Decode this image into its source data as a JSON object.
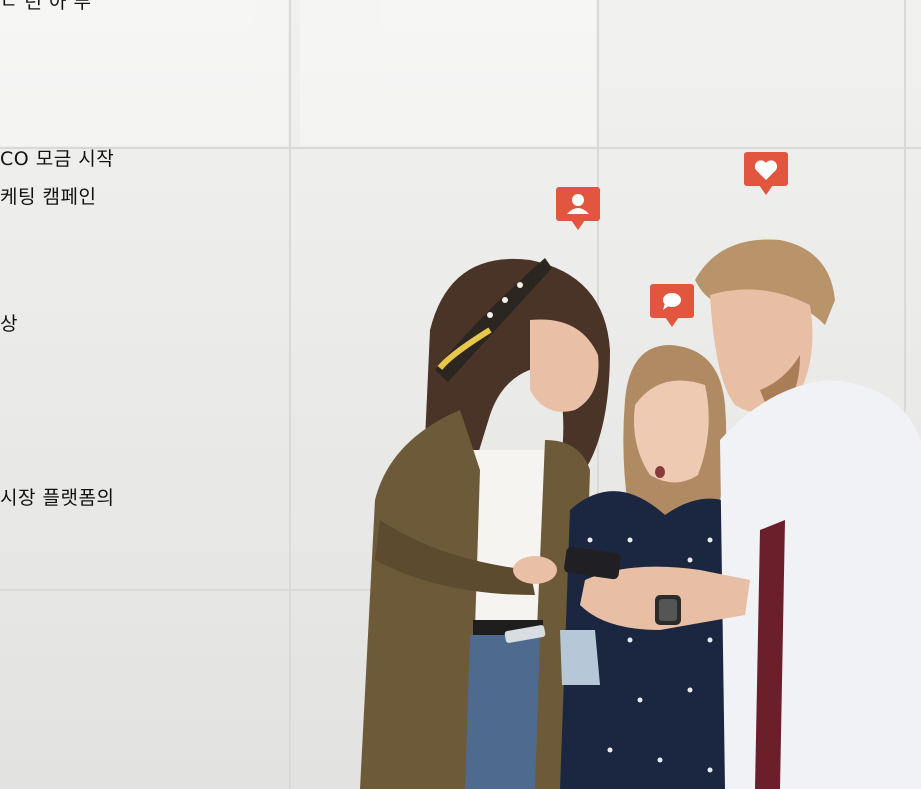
{
  "text_lines": [
    "ㄴ 런 아 푸",
    "CO 모금 시작",
    "케팅 캠페인",
    "상",
    "시장 플랫폼의"
  ],
  "bubbles": [
    {
      "icon": "person-icon",
      "color": "#e2553f"
    },
    {
      "icon": "heart-icon",
      "color": "#e2553f"
    },
    {
      "icon": "chat-icon",
      "color": "#e2553f"
    }
  ]
}
